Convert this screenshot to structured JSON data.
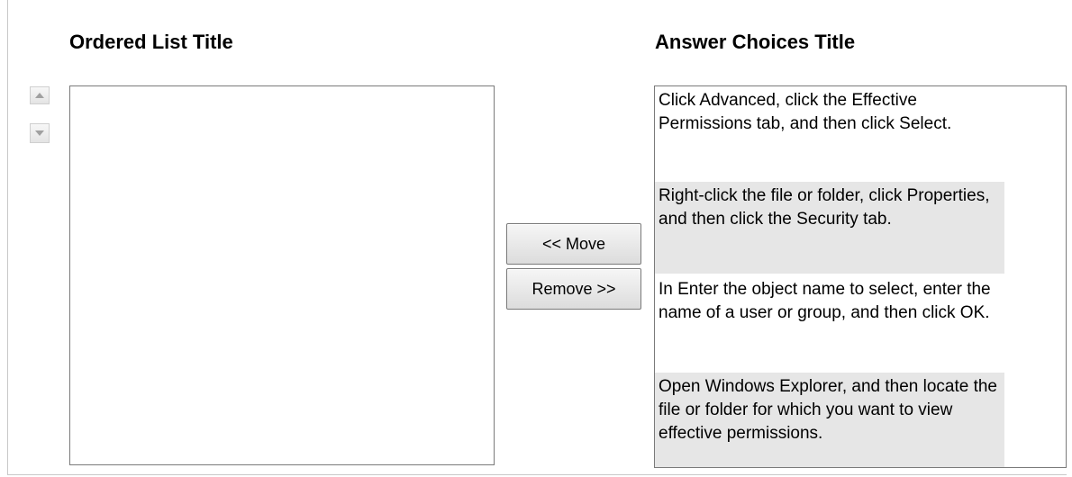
{
  "ordered_list": {
    "title": "Ordered List Title",
    "items": []
  },
  "reorder": {
    "up_icon": "triangle-up-icon",
    "down_icon": "triangle-down-icon"
  },
  "buttons": {
    "move_label": "<< Move",
    "remove_label": "Remove >>"
  },
  "answer_choices": {
    "title": "Answer Choices Title",
    "items": [
      {
        "text": "Click Advanced, click the Effective Permissions tab, and then click Select."
      },
      {
        "text": "Right-click the file or folder, click Properties, and then click the Security tab."
      },
      {
        "text": "In Enter the object name to select, enter the name of a user or group, and then click OK."
      },
      {
        "text": "Open Windows Explorer, and then locate the file or folder for which you want to view effective permissions."
      }
    ]
  },
  "colors": {
    "alternate_row": "#e6e6e6",
    "border": "#7a7a7a"
  }
}
